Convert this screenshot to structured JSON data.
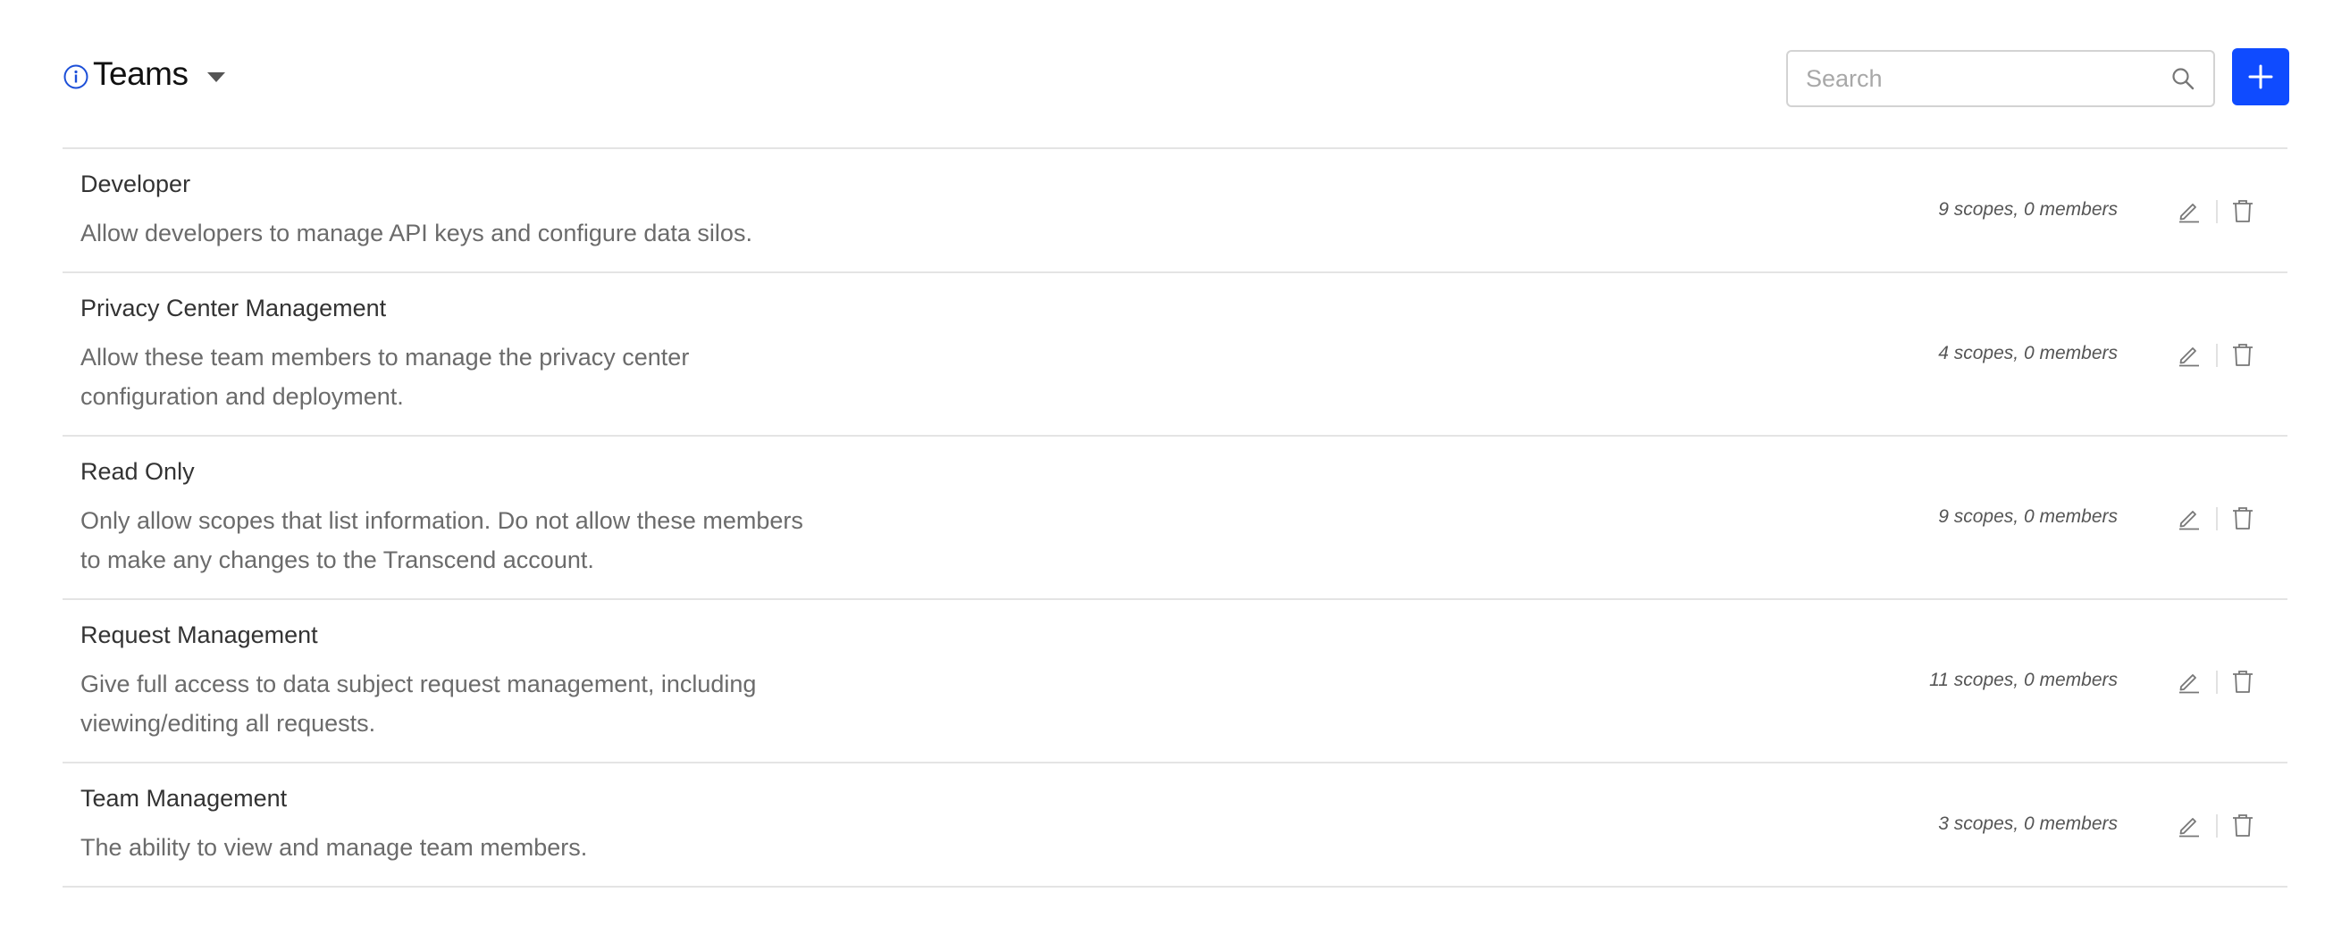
{
  "header": {
    "title": "Teams"
  },
  "search": {
    "placeholder": "Search",
    "value": ""
  },
  "teams": [
    {
      "name": "Developer",
      "description": "Allow developers to manage API keys and configure data silos.",
      "meta": "9 scopes, 0 members"
    },
    {
      "name": "Privacy Center Management",
      "description": "Allow these team members to manage the privacy center configuration and deployment.",
      "meta": "4 scopes, 0 members"
    },
    {
      "name": "Read Only",
      "description": "Only allow scopes that list information. Do not allow these members to make any changes to the Transcend account.",
      "meta": "9 scopes, 0 members"
    },
    {
      "name": "Request Management",
      "description": "Give full access to data subject request management, including viewing/editing all requests.",
      "meta": "11 scopes, 0 members"
    },
    {
      "name": "Team Management",
      "description": "The ability to view and manage team members.",
      "meta": "3 scopes, 0 members"
    }
  ],
  "icons": {
    "info": "info-icon",
    "dropdown": "chevron-down-icon",
    "search": "search-icon",
    "add": "plus-icon",
    "edit": "pencil-icon",
    "delete": "trash-icon"
  },
  "colors": {
    "accent": "#0f4bff",
    "info_icon": "#1c4fd8",
    "divider": "#e4e4e4"
  }
}
